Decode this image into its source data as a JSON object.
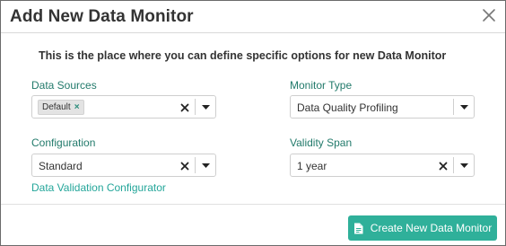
{
  "dialog": {
    "title": "Add New Data Monitor",
    "intro": "This is the place where you can define specific options for new Data Monitor"
  },
  "fields": {
    "data_sources": {
      "label": "Data Sources",
      "chips": [
        "Default"
      ]
    },
    "monitor_type": {
      "label": "Monitor Type",
      "value": "Data Quality Profiling"
    },
    "configuration": {
      "label": "Configuration",
      "value": "Standard"
    },
    "validity_span": {
      "label": "Validity Span",
      "value": "1 year"
    }
  },
  "links": {
    "configurator": "Data Validation Configurator"
  },
  "footer": {
    "create_label": "Create New Data Monitor"
  },
  "colors": {
    "label": "#227a6b",
    "link": "#24a69a",
    "primary": "#2fb09a"
  },
  "icons": {
    "close": "close-icon",
    "clear": "clear-icon",
    "dropdown": "chevron-down-icon",
    "create": "document-icon"
  }
}
